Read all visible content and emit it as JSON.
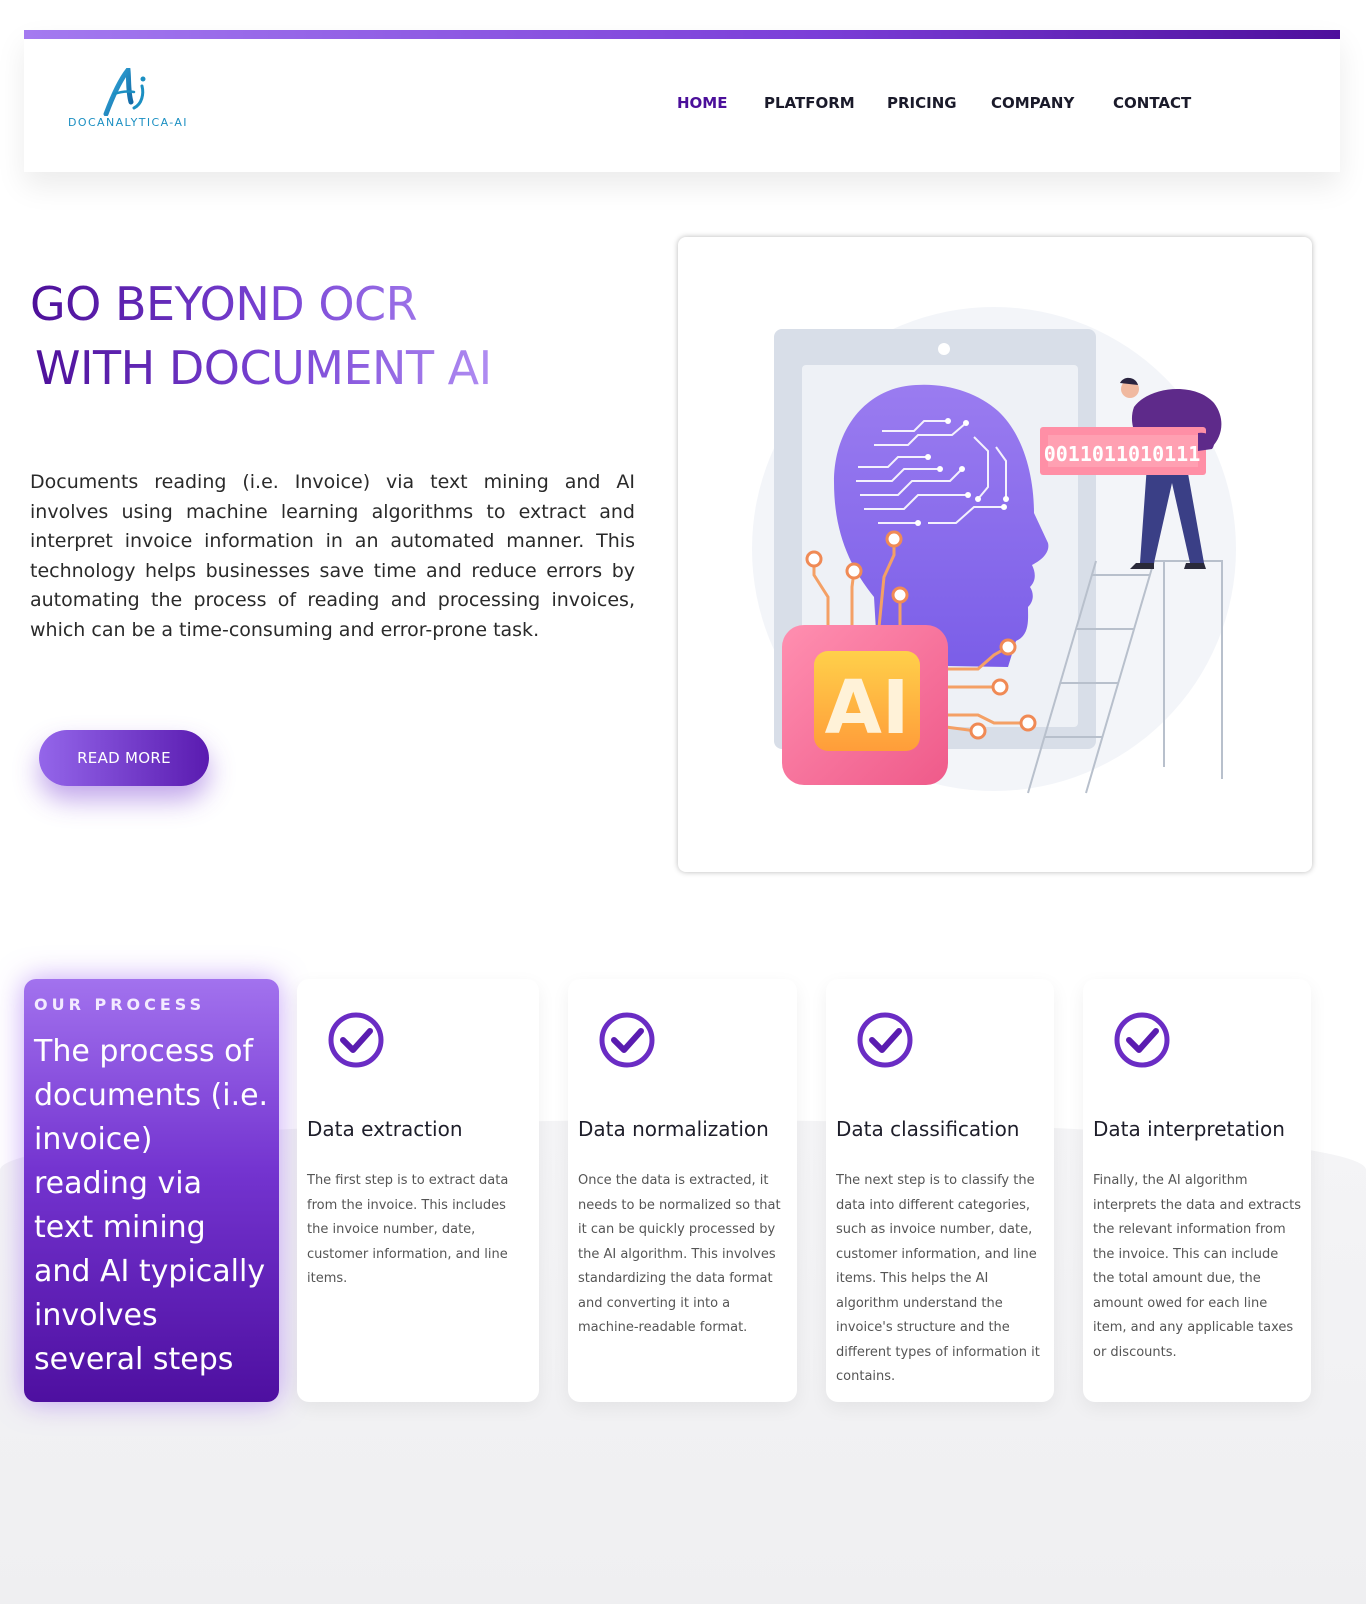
{
  "brand": {
    "logo_text": "DOCANALYTICA-AI"
  },
  "nav": {
    "items": [
      {
        "label": "HOME",
        "active": true
      },
      {
        "label": "PLATFORM",
        "active": false
      },
      {
        "label": "PRICING",
        "active": false
      },
      {
        "label": "COMPANY",
        "active": false
      },
      {
        "label": "CONTACT",
        "active": false
      }
    ]
  },
  "hero": {
    "title_line1": "GO BEYOND OCR",
    "title_line2": "WITH DOCUMENT AI",
    "description": "Documents reading (i.e. Invoice) via text mining and AI involves using machine learning algorithms to extract and interpret invoice information in an automated manner. This technology helps businesses save time and reduce errors by automating the process of reading and processing invoices, which can be a time-consuming and error-prone task.",
    "cta_label": "READ MORE",
    "illustration": {
      "binary_text": "0011011010111",
      "chip_text": "AI"
    }
  },
  "process": {
    "eyebrow": "OUR PROCESS",
    "heading": "The process of documents (i.e. invoice) reading via text mining and AI typically involves several steps",
    "steps": [
      {
        "title": "Data extraction",
        "text": "The first step is to extract data from the invoice. This includes the invoice number, date, customer information, and line items."
      },
      {
        "title": "Data normalization",
        "text": "Once the data is extracted, it needs to be normalized so that it can be quickly processed by the AI algorithm. This involves standardizing the data format and converting it into a machine-readable format."
      },
      {
        "title": "Data classification",
        "text": "The next step is to classify the data into different categories, such as invoice number, date, customer information, and line items. This helps the AI algorithm understand the invoice's structure and the different types of information it contains."
      },
      {
        "title": "Data interpretation",
        "text": "Finally, the AI algorithm interprets the data and extracts the relevant information from the invoice. This can include the total amount due, the amount owed for each line item, and any applicable taxes or discounts."
      }
    ]
  },
  "colors": {
    "brand_purple_dark": "#4b0f9a",
    "brand_purple_light": "#a47af0",
    "logo_blue": "#1b8fc2"
  }
}
